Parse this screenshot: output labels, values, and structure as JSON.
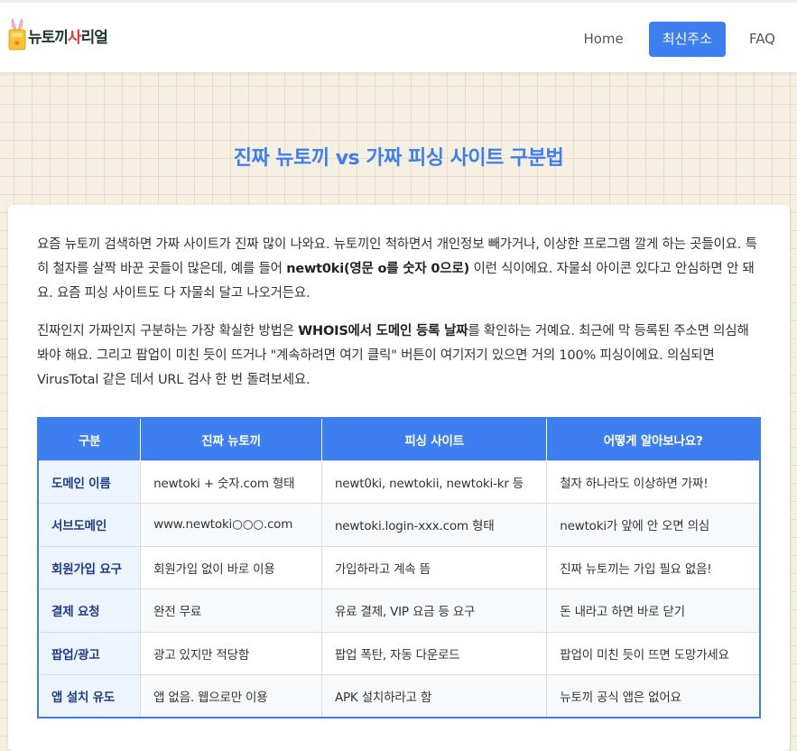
{
  "header": {
    "logo_parts": [
      "뉴토끼",
      "사",
      "리얼"
    ],
    "nav": {
      "home": "Home",
      "latest": "최신주소",
      "faq": "FAQ"
    }
  },
  "page_title": "진짜 뉴토끼 vs 가짜 피싱 사이트 구분법",
  "intro": {
    "p1_a": "요즘 뉴토끼 검색하면 가짜 사이트가 진짜 많이 나와요. 뉴토끼인 척하면서 개인정보 빼가거나, 이상한 프로그램 깔게 하는 곳들이요. 특히 철자를 살짝 바꾼 곳들이 많은데, 예를 들어 ",
    "p1_bold": "newt0ki(영문 o를 숫자 0으로)",
    "p1_b": " 이런 식이에요. 자물쇠 아이콘 있다고 안심하면 안 돼요. 요즘 피싱 사이트도 다 자물쇠 달고 나오거든요.",
    "p2_a": "진짜인지 가짜인지 구분하는 가장 확실한 방법은 ",
    "p2_bold": "WHOIS에서 도메인 등록 날짜",
    "p2_b": "를 확인하는 거예요. 최근에 막 등록된 주소면 의심해봐야 해요. 그리고 팝업이 미친 듯이 뜨거나 \"계속하려면 여기 클릭\" 버튼이 여기저기 있으면 거의 100% 피싱이에요. 의심되면 VirusTotal 같은 데서 URL 검사 한 번 돌려보세요."
  },
  "table": {
    "headers": [
      "구분",
      "진짜 뉴토끼",
      "피싱 사이트",
      "어떻게 알아보나요?"
    ],
    "rows": [
      [
        "도메인 이름",
        "newtoki + 숫자.com 형태",
        "newt0ki, newtokii, newtoki-kr 등",
        "철자 하나라도 이상하면 가짜!"
      ],
      [
        "서브도메인",
        "www.newtoki○○○.com",
        "newtoki.login-xxx.com 형태",
        "newtoki가 앞에 안 오면 의심"
      ],
      [
        "회원가입 요구",
        "회원가입 없이 바로 이용",
        "가입하라고 계속 뜸",
        "진짜 뉴토끼는 가입 필요 없음!"
      ],
      [
        "결제 요청",
        "완전 무료",
        "유료 결제, VIP 요금 등 요구",
        "돈 내라고 하면 바로 닫기"
      ],
      [
        "팝업/광고",
        "광고 있지만 적당함",
        "팝업 폭탄, 자동 다운로드",
        "팝업이 미친 듯이 뜨면 도망가세요"
      ],
      [
        "앱 설치 유도",
        "앱 없음. 웹으로만 이용",
        "APK 설치하라고 함",
        "뉴토끼 공식 앱은 없어요"
      ]
    ]
  },
  "colors": {
    "accent": "#3d7ef0",
    "row_header_text": "#1d3d8a",
    "background": "#f6f0e3"
  }
}
